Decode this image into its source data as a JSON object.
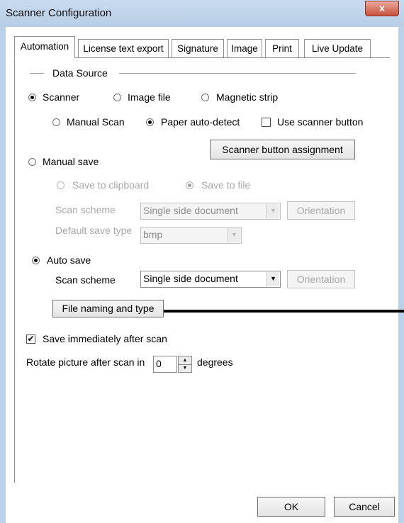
{
  "window": {
    "title": "Scanner Configuration",
    "close_glyph": "x"
  },
  "tabs": [
    {
      "label": "Automation",
      "active": true
    },
    {
      "label": "License text export"
    },
    {
      "label": "Signature"
    },
    {
      "label": "Image"
    },
    {
      "label": "Print"
    },
    {
      "label": "Live Update"
    }
  ],
  "data_source": {
    "heading": "Data Source",
    "scanner": "Scanner",
    "image_file": "Image file",
    "magnetic_strip": "Magnetic strip",
    "manual_scan": "Manual Scan",
    "paper_auto_detect": "Paper auto-detect",
    "use_scanner_button": "Use scanner button",
    "scanner_button_assignment": "Scanner button assignment"
  },
  "manual_save": {
    "label": "Manual save",
    "save_to_clipboard": "Save to clipboard",
    "save_to_file": "Save to file",
    "scan_scheme_label": "Scan scheme",
    "scan_scheme_value": "Single side document",
    "orientation": "Orientation",
    "default_save_type_label": "Default save type",
    "default_save_type_value": "bmp"
  },
  "auto_save": {
    "label": "Auto save",
    "scan_scheme_label": "Scan scheme",
    "scan_scheme_value": "Single side document",
    "orientation": "Orientation",
    "file_naming": "File naming and type"
  },
  "save_immediately": "Save immediately after scan",
  "rotate": {
    "label": "Rotate picture after scan in",
    "value": "0",
    "unit": "degrees"
  },
  "footer": {
    "ok": "OK",
    "cancel": "Cancel"
  },
  "icons": {
    "combo_arrow": "▼",
    "spin_up": "▲",
    "spin_down": "▼",
    "check": "✔"
  },
  "colors": {
    "titlebar": "#c9dbee",
    "close_button": "#c9503c",
    "disabled_text": "#a8a8a8"
  }
}
